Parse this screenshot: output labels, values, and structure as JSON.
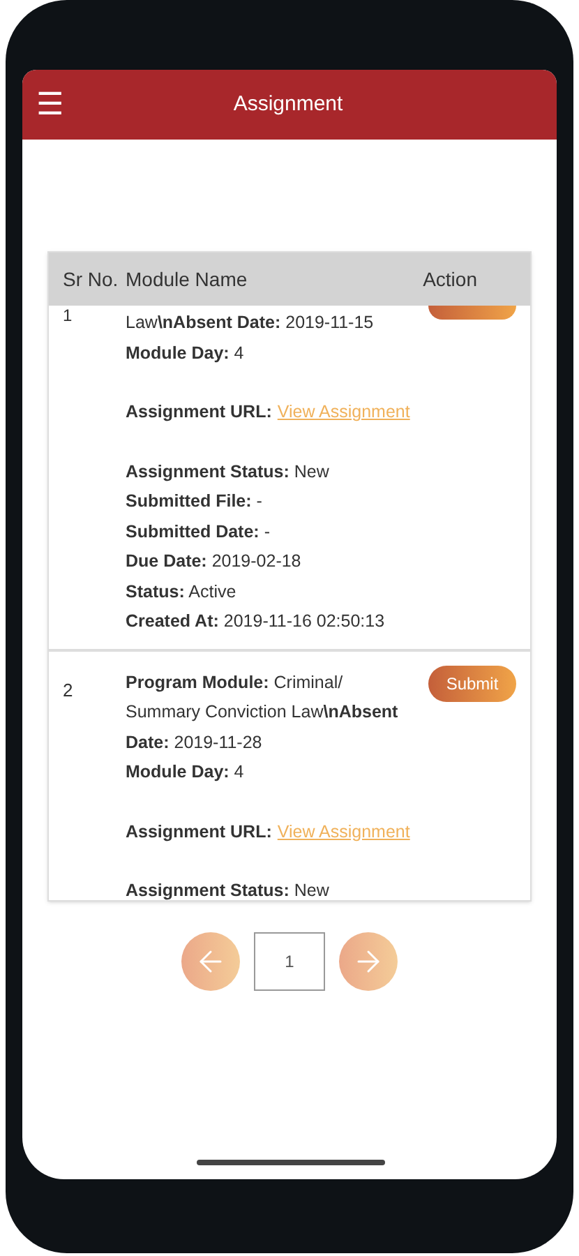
{
  "header": {
    "title": "Assignment",
    "menu": "☰"
  },
  "table": {
    "columns": [
      "Sr No.",
      "Module Name",
      "Action"
    ],
    "rows": [
      {
        "sr": "1",
        "action": {
          "kind": "cut"
        },
        "groups": [
          {
            "lines": [
              {
                "kind": "text",
                "text": "Law**\\nAbsent Date:** 2019-11-15"
              },
              {
                "kind": "text",
                "text": "**Module Day:** 4"
              }
            ]
          },
          {
            "lines": [
              {
                "kind": "link",
                "label": "Assignment URL:",
                "link": "View Assignment"
              }
            ]
          },
          {
            "lines": [
              {
                "kind": "text",
                "text": "**Assignment Status:** New"
              },
              {
                "kind": "text",
                "text": "**Submitted File:** -"
              },
              {
                "kind": "text",
                "text": "**Submitted Date:** -"
              },
              {
                "kind": "text",
                "text": "**Due Date:** 2019-02-18"
              },
              {
                "kind": "text",
                "text": "**Status:** Active"
              },
              {
                "kind": "text",
                "text": "**Created At:** 2019-11-16 02:50:13"
              }
            ]
          }
        ]
      },
      {
        "sr": "2",
        "action": {
          "kind": "button",
          "label": "Submit"
        },
        "groups": [
          {
            "lines": [
              {
                "kind": "text",
                "text": "**Program Module:** Criminal/ Summary Conviction Law**\\nAbsent Date:** 2019-11-28"
              },
              {
                "kind": "text",
                "text": "**Module Day:** 4"
              }
            ]
          },
          {
            "lines": [
              {
                "kind": "link",
                "label": "Assignment URL:",
                "link": "View Assignment"
              }
            ]
          },
          {
            "lines": [
              {
                "kind": "text",
                "text": "**Assignment Status:** New"
              }
            ]
          }
        ]
      }
    ]
  },
  "pagination": {
    "page": "1"
  }
}
